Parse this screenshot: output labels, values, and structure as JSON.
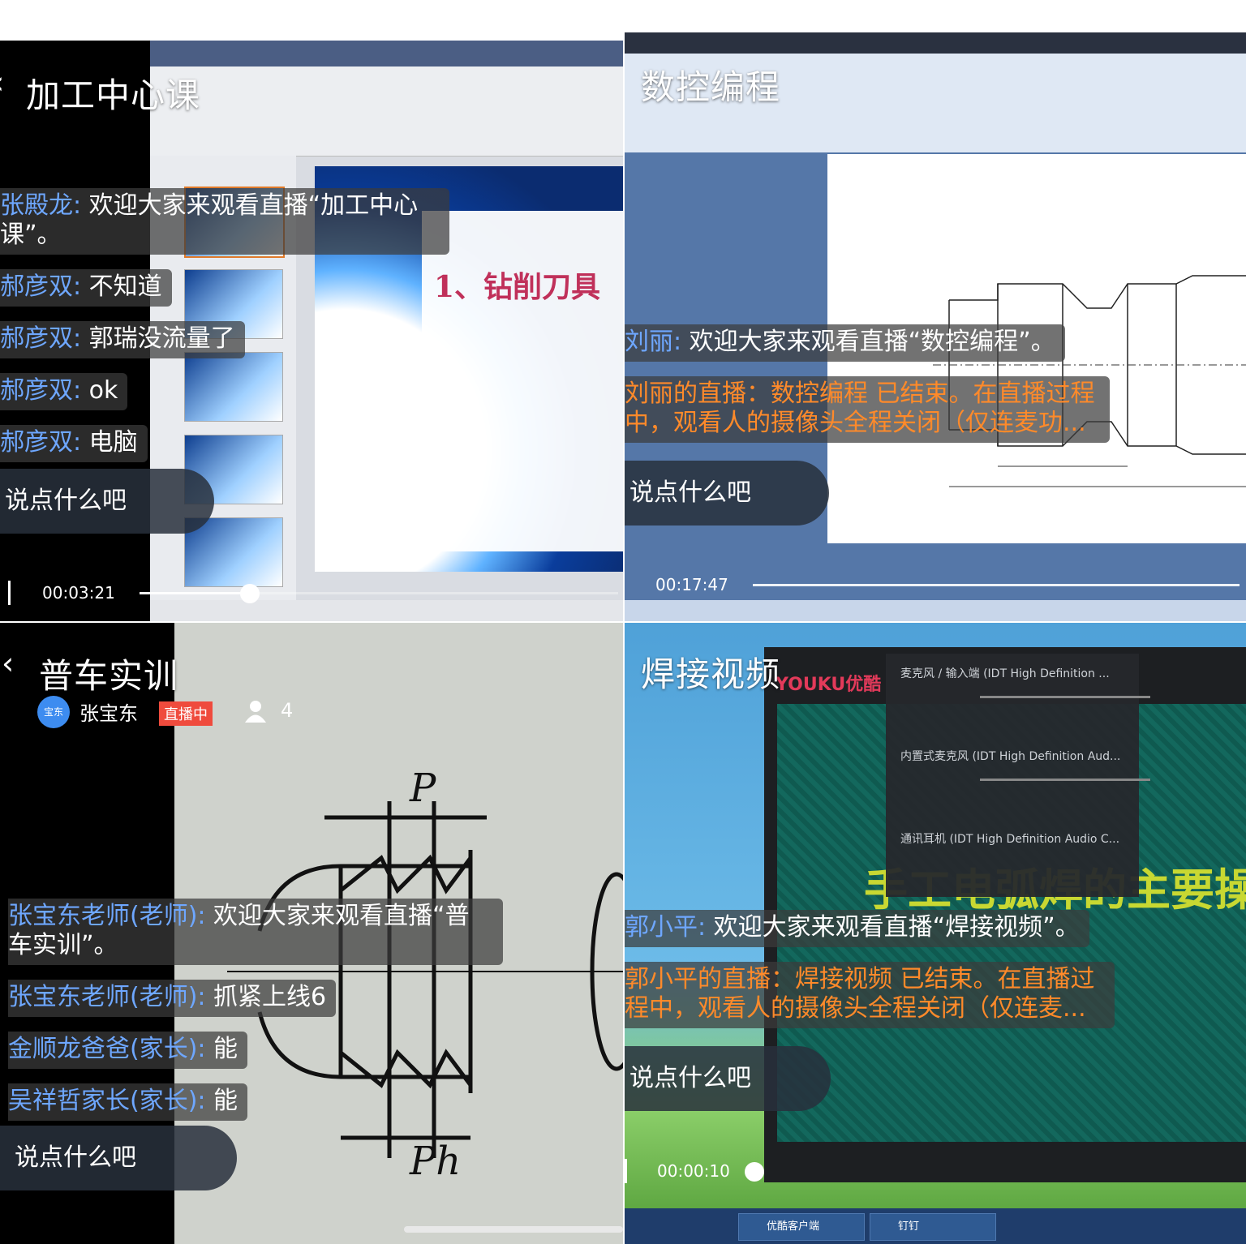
{
  "panels": [
    {
      "title": "加工中心课",
      "back_glyph": "‹",
      "slide_title": "1、钻削刀具",
      "messages": [
        {
          "name": "张殿龙:",
          "text": " 欢迎大家来观看直播“加工中心课”。"
        },
        {
          "name": "郝彦双:",
          "text": " 不知道"
        },
        {
          "name": "郝彦双:",
          "text": " 郭瑞没流量了"
        },
        {
          "name": "郝彦双:",
          "text": " ok"
        },
        {
          "name": "郝彦双:",
          "text": " 电脑"
        }
      ],
      "input_placeholder": "说点什么吧",
      "time": "00:03:21",
      "progress": 0.23
    },
    {
      "title": "数控编程",
      "messages": [
        {
          "name": "刘丽:",
          "text": " 欢迎大家来观看直播“数控编程”。"
        }
      ],
      "system_message": "刘丽的直播：数控编程 已结束。在直播过程中，观看人的摄像头全程关闭（仅连麦功...",
      "input_placeholder": "说点什么吧",
      "time": "00:17:47",
      "progress": 1.0
    },
    {
      "title": "普车实训",
      "back_glyph": "‹",
      "anchor": {
        "avatar_text": "宝东",
        "name": "张宝东",
        "live_badge": "直播中",
        "viewers": "4"
      },
      "drawing_labels": {
        "p": "P",
        "ph": "Ph"
      },
      "messages": [
        {
          "name": "张宝东老师(老师):",
          "text": " 欢迎大家来观看直播“普车实训”。"
        },
        {
          "name": "张宝东老师(老师):",
          "text": " 抓紧上线6"
        },
        {
          "name": "金顺龙爸爸(家长):",
          "text": " 能"
        },
        {
          "name": "吴祥哲家长(家长):",
          "text": " 能"
        }
      ],
      "input_placeholder": "说点什么吧"
    },
    {
      "title": "焊接视频",
      "video_subtitle": "手工电弧焊的主要操作技",
      "player_brand": "YOUKU优酷",
      "mic_popup": [
        "麦克风 / 输入端 (IDT High Definition ...",
        "内置式麦克风 (IDT High Definition Aud...",
        "通讯耳机 (IDT High Definition Audio C..."
      ],
      "messages": [
        {
          "name": "郭小平:",
          "text": " 欢迎大家来观看直播“焊接视频”。"
        }
      ],
      "system_message": "郭小平的直播：焊接视频 已结束。在直播过程中，观看人的摄像头全程关闭（仅连麦...",
      "input_placeholder": "说点什么吧",
      "time": "00:00:10",
      "progress": 0.0,
      "taskbar": [
        "优酷客户端",
        "钉钉"
      ]
    }
  ],
  "colors": {
    "username": "#6ea7ff",
    "system": "#ff8a2a",
    "live": "#ef4b3d"
  }
}
